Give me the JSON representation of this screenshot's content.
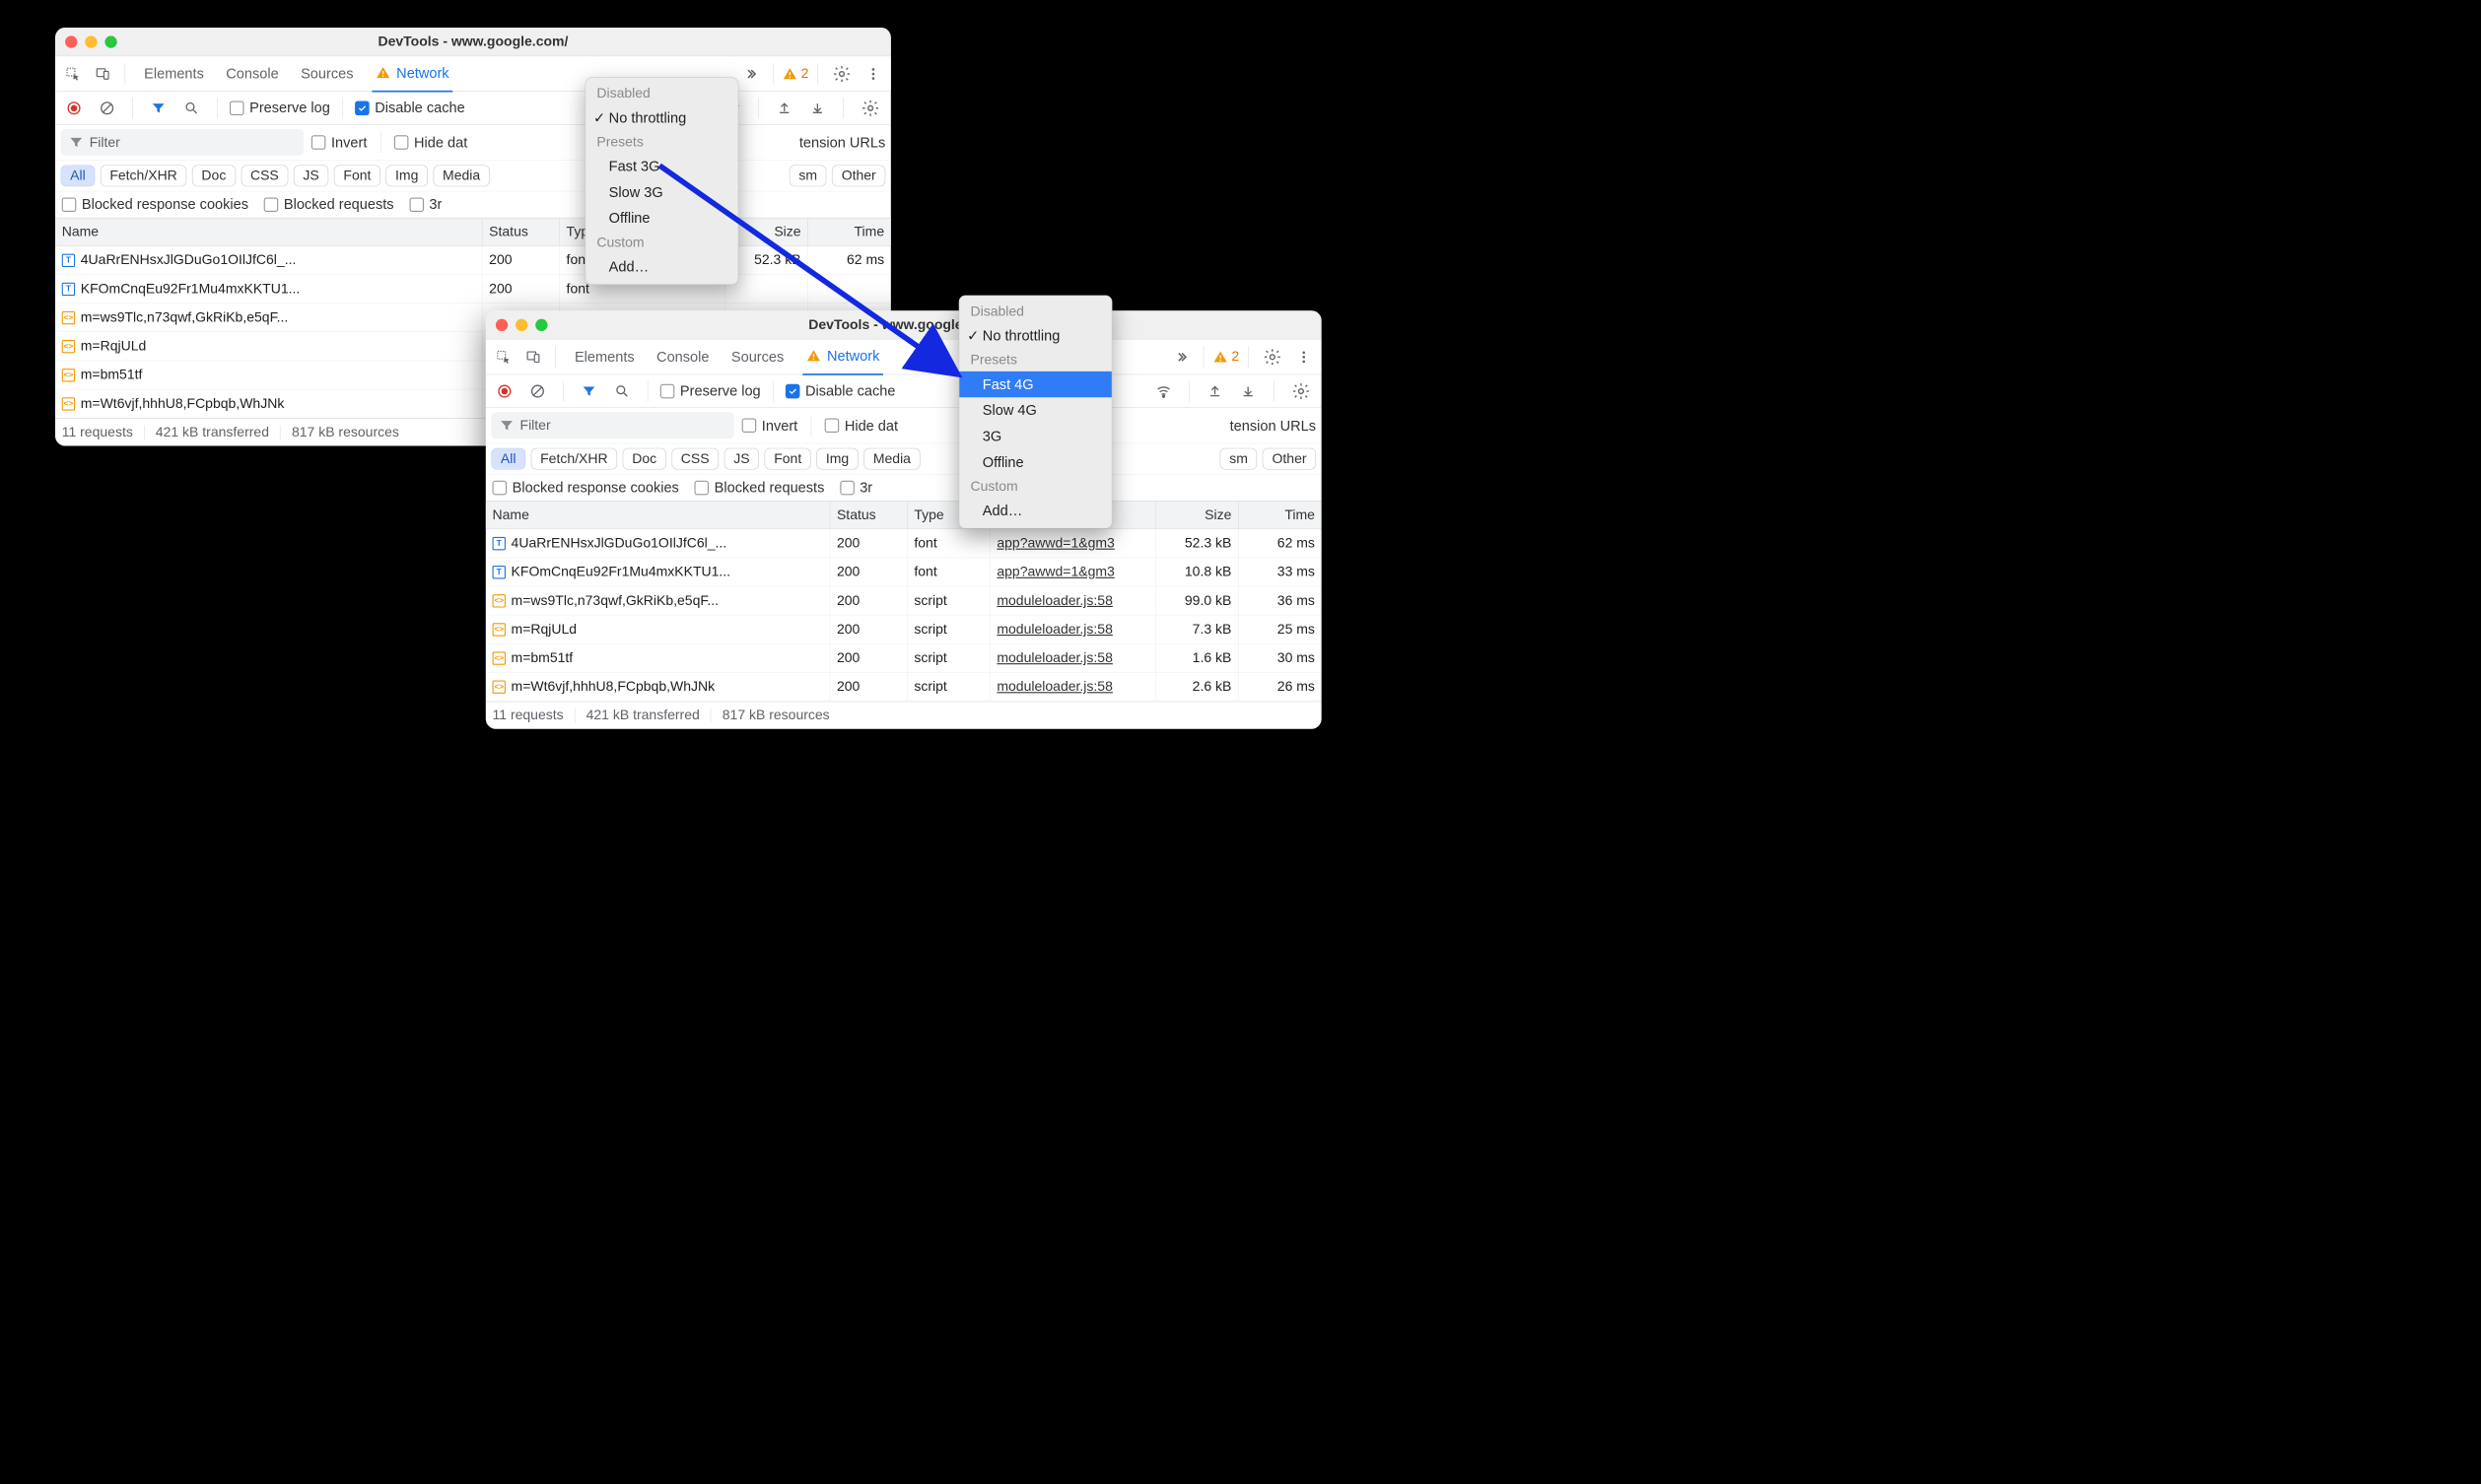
{
  "title": "DevTools - www.google.com/",
  "tabs": [
    "Elements",
    "Console",
    "Sources",
    "Network"
  ],
  "warn_count": "2",
  "preserve_log": "Preserve log",
  "disable_cache": "Disable cache",
  "filter_placeholder": "Filter",
  "invert": "Invert",
  "hide_data": "Hide data",
  "hide_data_cut": "Hide dat",
  "extension_urls": "tension URLs",
  "extension_urls_cut": "tension URLs",
  "filter_chips": [
    "All",
    "Fetch/XHR",
    "Doc",
    "CSS",
    "JS",
    "Font",
    "Img",
    "Media"
  ],
  "chip_sm_cut": "sm",
  "chip_other": "Other",
  "blocked_cookies": "Blocked response cookies",
  "blocked_requests": "Blocked requests",
  "blocked_3rd_cut": "3r",
  "columns": {
    "name": "Name",
    "status": "Status",
    "type": "Type",
    "size": "Size",
    "time": "Time"
  },
  "rows": [
    {
      "icon": "font",
      "name": "4UaRrENHsxJlGDuGo1OIlJfC6l_...",
      "status": "200",
      "type": "font",
      "initiator": "app?awwd=1&gm3",
      "size": "52.3 kB",
      "time": "62 ms"
    },
    {
      "icon": "font",
      "name": "KFOmCnqEu92Fr1Mu4mxKKTU1...",
      "status": "200",
      "type": "font",
      "initiator": "app?awwd=1&gm3",
      "size": "10.8 kB",
      "time": "33 ms"
    },
    {
      "icon": "script",
      "name": "m=ws9Tlc,n73qwf,GkRiKb,e5qF...",
      "status": "200",
      "type": "script",
      "initiator": "moduleloader.js:58",
      "size": "99.0 kB",
      "time": "36 ms"
    },
    {
      "icon": "script",
      "name": "m=RqjULd",
      "status": "200",
      "type": "script",
      "initiator": "moduleloader.js:58",
      "size": "7.3 kB",
      "time": "25 ms"
    },
    {
      "icon": "script",
      "name": "m=bm51tf",
      "status": "200",
      "type": "script",
      "initiator": "moduleloader.js:58",
      "size": "1.6 kB",
      "time": "30 ms"
    },
    {
      "icon": "script",
      "name": "m=Wt6vjf,hhhU8,FCpbqb,WhJNk",
      "status": "200",
      "type": "script",
      "initiator": "moduleloader.js:58",
      "size": "2.6 kB",
      "time": "26 ms"
    }
  ],
  "rows_left_visible": [
    0,
    1,
    2,
    3,
    4,
    5
  ],
  "rows_left_type_cut": [
    false,
    false,
    true,
    true,
    true,
    true
  ],
  "status": {
    "requests": "11 requests",
    "transferred": "421 kB transferred",
    "resources": "817 kB resources"
  },
  "dropdown1": {
    "groups": [
      {
        "heading": "Disabled",
        "items": [
          {
            "label": "No throttling",
            "checked": true
          }
        ]
      },
      {
        "heading": "Presets",
        "items": [
          {
            "label": "Fast 3G"
          },
          {
            "label": "Slow 3G"
          },
          {
            "label": "Offline"
          }
        ]
      },
      {
        "heading": "Custom",
        "items": [
          {
            "label": "Add…"
          }
        ]
      }
    ]
  },
  "dropdown2": {
    "groups": [
      {
        "heading": "Disabled",
        "items": [
          {
            "label": "No throttling",
            "checked": true
          }
        ]
      },
      {
        "heading": "Presets",
        "items": [
          {
            "label": "Fast 4G",
            "selected": true
          },
          {
            "label": "Slow 4G"
          },
          {
            "label": "3G"
          },
          {
            "label": "Offline"
          }
        ]
      },
      {
        "heading": "Custom",
        "items": [
          {
            "label": "Add…"
          }
        ]
      }
    ]
  }
}
